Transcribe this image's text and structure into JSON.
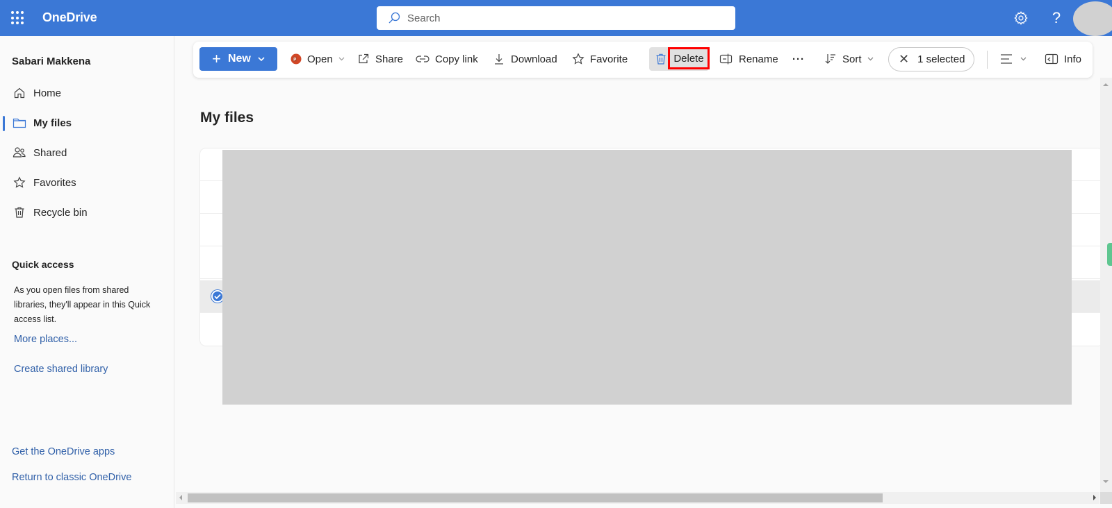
{
  "header": {
    "app_title": "OneDrive",
    "search_placeholder": "Search",
    "icons": {
      "app_launcher": "waffle-icon",
      "settings": "gear-icon",
      "help": "help-icon",
      "avatar": "avatar"
    },
    "help_glyph": "?"
  },
  "sidebar": {
    "user_name": "Sabari Makkena",
    "nav": [
      {
        "label": "Home",
        "icon": "home-icon",
        "active": false
      },
      {
        "label": "My files",
        "icon": "folder-icon",
        "active": true
      },
      {
        "label": "Shared",
        "icon": "people-icon",
        "active": false
      },
      {
        "label": "Favorites",
        "icon": "star-icon",
        "active": false
      },
      {
        "label": "Recycle bin",
        "icon": "trash-icon",
        "active": false
      }
    ],
    "quick_access": {
      "title": "Quick access",
      "description": "As you open files from shared libraries, they'll appear in this Quick access list.",
      "more_places": "More places...",
      "create_library": "Create shared library"
    },
    "footer": {
      "get_apps": "Get the OneDrive apps",
      "return_classic": "Return to classic OneDrive"
    }
  },
  "toolbar": {
    "new_label": "New",
    "open_label": "Open",
    "share_label": "Share",
    "copy_link_label": "Copy link",
    "download_label": "Download",
    "favorite_label": "Favorite",
    "delete_label": "Delete",
    "rename_label": "Rename",
    "more_label": "···",
    "sort_label": "Sort",
    "selected_label": "1 selected",
    "info_label": "Info"
  },
  "main": {
    "page_title": "My files",
    "rows": [
      {
        "selected": false
      },
      {
        "selected": false
      },
      {
        "selected": false
      },
      {
        "selected": false
      },
      {
        "selected": true
      },
      {
        "selected": false
      }
    ]
  },
  "colors": {
    "brand": "#3b78d6",
    "link": "#2f5fa8",
    "highlight_box": "#ff0000",
    "redaction": "#d1d1d1"
  }
}
